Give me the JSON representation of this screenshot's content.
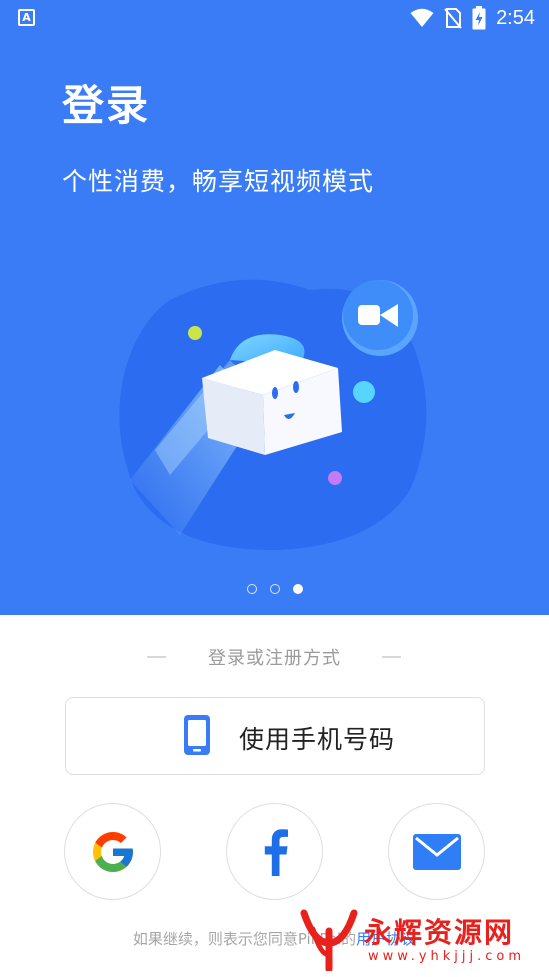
{
  "status_bar": {
    "app_badge": "A",
    "time": "2:54",
    "icons": [
      "wifi-icon",
      "no-sim-icon",
      "battery-charging-icon"
    ]
  },
  "hero": {
    "title": "登录",
    "subtitle": "个性消费，畅享短视频模式",
    "illustration": "flying-cube-video-illustration",
    "carousel": {
      "count": 3,
      "active_index": 2
    }
  },
  "login": {
    "section_label": "登录或注册方式",
    "phone_button_label": "使用手机号码",
    "phone_icon": "smartphone-icon",
    "social_buttons": [
      "google-icon",
      "facebook-icon",
      "email-icon"
    ]
  },
  "footer": {
    "text_before": "如果继续，则表示您同意PikPal的",
    "link_text": "用户协议"
  },
  "watermark": {
    "name": "永辉资源网",
    "url": "www.yhkjjj.com"
  },
  "colors": {
    "brand_blue": "#3a7cf6",
    "watermark_red": "#e8211d",
    "facebook_blue": "#1e6ee8"
  }
}
